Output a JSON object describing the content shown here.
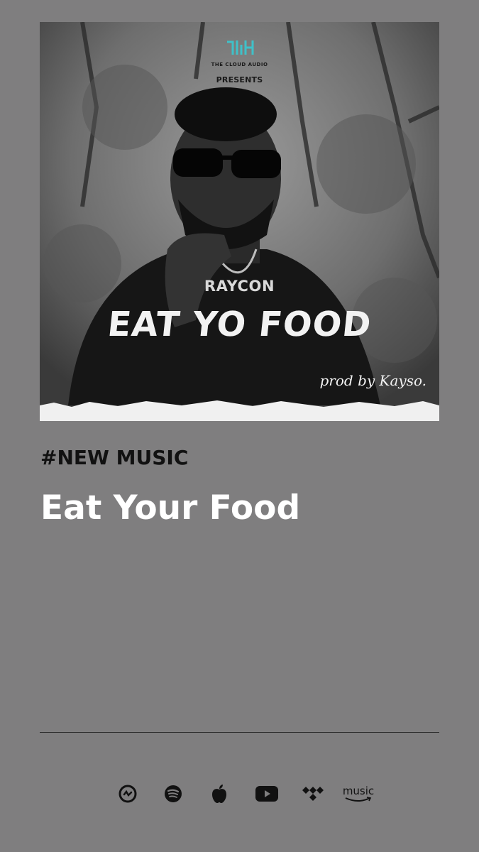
{
  "cover": {
    "brand_name": "THE CLOUD AUDIO",
    "presents": "PRESENTS",
    "artist": "RAYCON",
    "title": "EAT YO FOOD",
    "producer": "prod by Kayso.",
    "logo_icon": "cloud-audio-logo-icon"
  },
  "post": {
    "tag": "#NEW MUSIC",
    "title": "Eat Your Food"
  },
  "platforms": [
    {
      "name": "audiomack",
      "icon": "audiomack-icon"
    },
    {
      "name": "spotify",
      "icon": "spotify-icon"
    },
    {
      "name": "apple-music",
      "icon": "apple-icon"
    },
    {
      "name": "youtube",
      "icon": "youtube-icon"
    },
    {
      "name": "tidal",
      "icon": "tidal-icon"
    },
    {
      "name": "amazon-music",
      "icon": "amazon-music-icon",
      "label": "music"
    }
  ],
  "colors": {
    "background": "#7f7e7f",
    "logo_accent": "#3fc1c9",
    "headline": "#ffffff",
    "tag": "#111111"
  }
}
